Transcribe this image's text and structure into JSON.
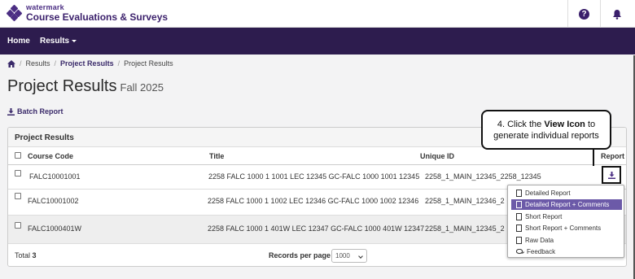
{
  "header": {
    "brand": "watermark",
    "title": "Course Evaluations & Surveys"
  },
  "nav": {
    "home": "Home",
    "results": "Results"
  },
  "breadcrumb": {
    "items": [
      "Results",
      "Project Results",
      "Project Results"
    ]
  },
  "page": {
    "title": "Project Results",
    "subtitle": "Fall 2025"
  },
  "batch_report": "Batch Report",
  "panel": {
    "title": "Project Results",
    "columns": {
      "course_code": "Course Code",
      "title": "Title",
      "unique_id": "Unique ID",
      "report": "Report"
    },
    "rows": [
      {
        "course_code": "FALC10001001",
        "title": "2258 FALC 1000 1 1001 LEC 12345 GC-FALC 1000 1001 12345",
        "unique_id": "2258_1_MAIN_12345_2258_12345"
      },
      {
        "course_code": "FALC10001002",
        "title": "2258 FALC 1000 1 1002 LEC 12346 GC-FALC 1000 1002 12346",
        "unique_id": "2258_1_MAIN_12346_2"
      },
      {
        "course_code": "FALC1000401W",
        "title": "2258 FALC 1000 1 401W LEC 12347 GC-FALC 1000 401W 12347",
        "unique_id": "2258_1_MAIN_12345_2"
      }
    ],
    "footer": {
      "total_label": "Total",
      "total_value": "3",
      "records_label": "Records per page",
      "records_value": "1000"
    }
  },
  "dropdown": {
    "items": [
      {
        "label": "Detailed Report",
        "active": false
      },
      {
        "label": "Detailed Report + Comments",
        "active": true
      },
      {
        "label": "Short Report",
        "active": false
      },
      {
        "label": "Short Report + Comments",
        "active": false
      },
      {
        "label": "Raw Data",
        "active": false
      },
      {
        "label": "Feedback",
        "active": false
      }
    ]
  },
  "callout": {
    "prefix": "4. Click the",
    "bold": "View Icon",
    "suffix": "to",
    "line2": "generate individual reports"
  },
  "colors": {
    "nav_bg": "#2d1c4e",
    "brand": "#4b2e83",
    "active_item": "#6c5aa8"
  }
}
